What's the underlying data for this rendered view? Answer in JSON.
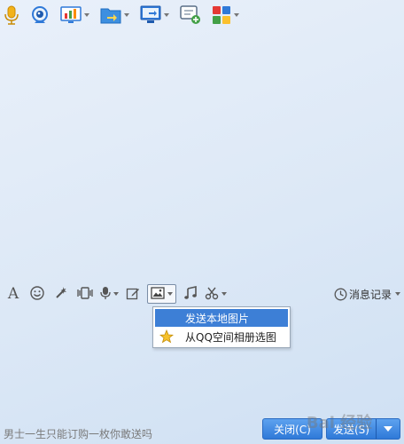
{
  "toolbar": {
    "icons": [
      "microphone-icon",
      "webcam-icon",
      "screen-share-icon",
      "send-file-icon",
      "remote-desktop-icon",
      "message-add-icon",
      "apps-grid-icon"
    ]
  },
  "input_toolbar": {
    "font_label": "A",
    "history_label": "消息记录"
  },
  "popup_menu": {
    "items": [
      {
        "label": "发送本地图片",
        "highlighted": true
      },
      {
        "label": "从QQ空间相册选图",
        "highlighted": false,
        "icon": "star-icon"
      }
    ]
  },
  "footer": {
    "status_text": "男士一生只能订购一枚你敢送吗",
    "close_label": "关闭(C)",
    "send_label": "发送(S)"
  },
  "colors": {
    "accent": "#3d7fd6",
    "button_blue": "#2f79d8"
  },
  "watermark": {
    "text": "Bai 经验"
  }
}
